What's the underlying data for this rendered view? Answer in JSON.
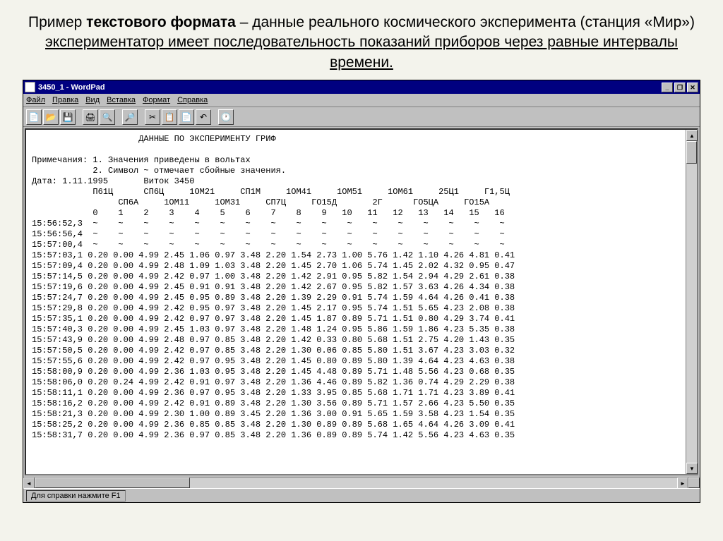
{
  "slide_title": {
    "part1": "Пример ",
    "bold": "текстового формата",
    "part2": " – данные реального космического эксперимента (станция «Мир»)  ",
    "underline": "экспериментатор имеет последовательность показаний приборов через равные интервалы времени."
  },
  "window": {
    "title": "3450_1 - WordPad",
    "min": "_",
    "max": "❐",
    "close": "✕"
  },
  "menu": {
    "file": "Файл",
    "edit": "Правка",
    "view": "Вид",
    "insert": "Вставка",
    "format": "Формат",
    "help": "Справка"
  },
  "toolbar_icons": {
    "new": "📄",
    "open": "📂",
    "save": "💾",
    "print": "🖨",
    "preview": "🔍",
    "find": "🔎",
    "cut": "✂",
    "copy": "📋",
    "paste": "📄",
    "undo": "↶",
    "datetime": "🕐"
  },
  "document": {
    "heading": "                     ДАННЫЕ ПО ЭКСПЕРИМЕНТУ ГРИФ",
    "notes_label": "Примечания:",
    "note1": " 1. Значения приведены в вольтах",
    "note2": "            2. Символ ~ отмечает сбойные значения.",
    "date_line": "Дата: 1.11.1995       Виток 3450",
    "header1": "            П61Ц      СП6Ц     1ОМ21     СП1М     1ОМ41     1ОМ51     1ОМ61     25Ц1     Г1,5Ц",
    "header2": "                 СП6А     1ОМ11     1ОМ31     СП7Ц     ГО15Д       2Г      ГО5ЦА     ГО15А",
    "header3": "            0    1    2    3    4    5    6    7    8    9   10   11   12   13   14   15   16",
    "rows": [
      "15:56:52,3  ~    ~    ~    ~    ~    ~    ~    ~    ~    ~    ~    ~    ~    ~    ~    ~    ~",
      "15:56:56,4  ~    ~    ~    ~    ~    ~    ~    ~    ~    ~    ~    ~    ~    ~    ~    ~    ~",
      "15:57:00,4  ~    ~    ~    ~    ~    ~    ~    ~    ~    ~    ~    ~    ~    ~    ~    ~    ~",
      "15:57:03,1 0.20 0.00 4.99 2.45 1.06 0.97 3.48 2.20 1.54 2.73 1.00 5.76 1.42 1.10 4.26 4.81 0.41",
      "15:57:09,4 0.20 0.00 4.99 2.48 1.09 1.03 3.48 2.20 1.45 2.70 1.06 5.74 1.45 2.02 4.32 0.95 0.47",
      "15:57:14,5 0.20 0.00 4.99 2.42 0.97 1.00 3.48 2.20 1.42 2.91 0.95 5.82 1.54 2.94 4.29 2.61 0.38",
      "15:57:19,6 0.20 0.00 4.99 2.45 0.91 0.91 3.48 2.20 1.42 2.67 0.95 5.82 1.57 3.63 4.26 4.34 0.38",
      "15:57:24,7 0.20 0.00 4.99 2.45 0.95 0.89 3.48 2.20 1.39 2.29 0.91 5.74 1.59 4.64 4.26 0.41 0.38",
      "15:57:29,8 0.20 0.00 4.99 2.42 0.95 0.97 3.48 2.20 1.45 2.17 0.95 5.74 1.51 5.65 4.23 2.08 0.38",
      "15:57:35,1 0.20 0.00 4.99 2.42 0.97 0.97 3.48 2.20 1.45 1.87 0.89 5.71 1.51 0.80 4.29 3.74 0.41",
      "15:57:40,3 0.20 0.00 4.99 2.45 1.03 0.97 3.48 2.20 1.48 1.24 0.95 5.86 1.59 1.86 4.23 5.35 0.38",
      "15:57:43,9 0.20 0.00 4.99 2.48 0.97 0.85 3.48 2.20 1.42 0.33 0.80 5.68 1.51 2.75 4.20 1.43 0.35",
      "15:57:50,5 0.20 0.00 4.99 2.42 0.97 0.85 3.48 2.20 1.30 0.06 0.85 5.80 1.51 3.67 4.23 3.03 0.32",
      "15:57:55,6 0.20 0.00 4.99 2.42 0.97 0.95 3.48 2.20 1.45 0.80 0.89 5.80 1.39 4.64 4.23 4.63 0.38",
      "15:58:00,9 0.20 0.00 4.99 2.36 1.03 0.95 3.48 2.20 1.45 4.48 0.89 5.71 1.48 5.56 4.23 0.68 0.35",
      "15:58:06,0 0.20 0.24 4.99 2.42 0.91 0.97 3.48 2.20 1.36 4.46 0.89 5.82 1.36 0.74 4.29 2.29 0.38",
      "15:58:11,1 0.20 0.00 4.99 2.36 0.97 0.95 3.48 2.20 1.33 3.95 0.85 5.68 1.71 1.71 4.23 3.89 0.41",
      "15:58:16,2 0.20 0.00 4.99 2.42 0.91 0.89 3.48 2.20 1.30 3.56 0.89 5.71 1.57 2.66 4.23 5.50 0.35",
      "15:58:21,3 0.20 0.00 4.99 2.30 1.00 0.89 3.45 2.20 1.36 3.00 0.91 5.65 1.59 3.58 4.23 1.54 0.35",
      "15:58:25,2 0.20 0.00 4.99 2.36 0.85 0.85 3.48 2.20 1.30 0.89 0.89 5.68 1.65 4.64 4.26 3.09 0.41",
      "15:58:31,7 0.20 0.00 4.99 2.36 0.97 0.85 3.48 2.20 1.36 0.89 0.89 5.74 1.42 5.56 4.23 4.63 0.35"
    ]
  },
  "statusbar": "Для справки нажмите F1"
}
